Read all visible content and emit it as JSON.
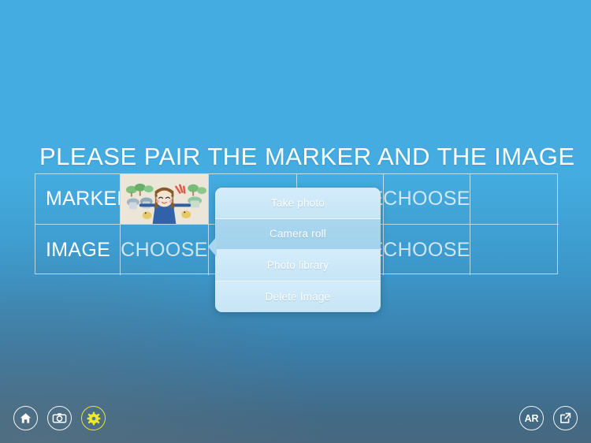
{
  "app": {
    "background_top_color": "#44ACE0",
    "background_bottom_color": "#486880",
    "accent_color": "#F0E92A"
  },
  "title": "PLEASE PAIR THE MARKER AND THE  IMAGE",
  "pair_table": {
    "rows": [
      {
        "label": "MARKER",
        "cells": [
          {
            "type": "image",
            "alt": "child drawing of a girl with trees and animals"
          },
          {
            "type": "empty",
            "label": ""
          },
          {
            "type": "choose",
            "label": "CHOOSE"
          },
          {
            "type": "choose",
            "label": "CHOOSE"
          },
          {
            "type": "empty",
            "label": ""
          }
        ]
      },
      {
        "label": "IMAGE",
        "cells": [
          {
            "type": "choose",
            "label": "CHOOSE"
          },
          {
            "type": "empty",
            "label": ""
          },
          {
            "type": "choose",
            "label": "CHOOSE"
          },
          {
            "type": "choose",
            "label": "CHOOSE"
          },
          {
            "type": "empty",
            "label": ""
          }
        ]
      }
    ]
  },
  "popover": {
    "items": [
      {
        "label": "Take photo",
        "selected": false
      },
      {
        "label": "Camera roll",
        "selected": true
      },
      {
        "label": "Photo library",
        "selected": false
      },
      {
        "label": "Delete Image",
        "selected": false
      }
    ]
  },
  "toolbar": {
    "left": [
      {
        "name": "home-button",
        "icon": "home-icon",
        "active": false
      },
      {
        "name": "camera-button",
        "icon": "camera-icon",
        "active": false
      },
      {
        "name": "settings-button",
        "icon": "gear-icon",
        "active": true
      }
    ],
    "right": [
      {
        "name": "ar-button",
        "icon": "ar-icon",
        "label": "AR",
        "active": false
      },
      {
        "name": "share-button",
        "icon": "share-export-icon",
        "active": false
      }
    ]
  }
}
